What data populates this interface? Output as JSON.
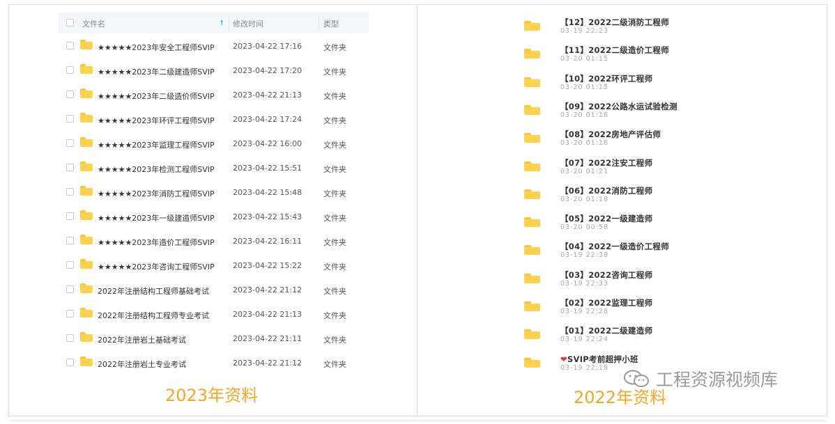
{
  "left_panel": {
    "header": {
      "name": "文件名",
      "time": "修改时间",
      "type": "类型"
    },
    "rows": [
      {
        "name": "★★★★★2023年安全工程师SVIP",
        "time": "2023-04-22 17:16",
        "type": "文件夹"
      },
      {
        "name": "★★★★★2023年二级建造师SVIP",
        "time": "2023-04-22 17:20",
        "type": "文件夹"
      },
      {
        "name": "★★★★★2023年二级造价师SVIP",
        "time": "2023-04-22 21:13",
        "type": "文件夹"
      },
      {
        "name": "★★★★★2023年环评工程师SVIP",
        "time": "2023-04-22 17:24",
        "type": "文件夹"
      },
      {
        "name": "★★★★★2023年监理工程师SVIP",
        "time": "2023-04-22 16:00",
        "type": "文件夹"
      },
      {
        "name": "★★★★★2023年检测工程师SVIP",
        "time": "2023-04-22 15:51",
        "type": "文件夹"
      },
      {
        "name": "★★★★★2023年消防工程师SVIP",
        "time": "2023-04-22 15:48",
        "type": "文件夹"
      },
      {
        "name": "★★★★★2023年一级建造师SVIP",
        "time": "2023-04-22 15:43",
        "type": "文件夹"
      },
      {
        "name": "★★★★★2023年造价工程师SVIP",
        "time": "2023-04-22 16:11",
        "type": "文件夹"
      },
      {
        "name": "★★★★★2023年咨询工程师SVIP",
        "time": "2023-04-22 15:22",
        "type": "文件夹"
      },
      {
        "name": "2022年注册结构工程师基础考试",
        "time": "2023-04-22 21:12",
        "type": "文件夹"
      },
      {
        "name": "2022年注册结构工程师专业考试",
        "time": "2023-04-22 21:13",
        "type": "文件夹"
      },
      {
        "name": "2022年注册岩土基础考试",
        "time": "2023-04-22 21:11",
        "type": "文件夹"
      },
      {
        "name": "2022年注册岩土专业考试",
        "time": "2023-04-22 21:12",
        "type": "文件夹"
      }
    ],
    "caption": "2023年资料"
  },
  "right_panel": {
    "items": [
      {
        "title": "【12】2022二级消防工程师",
        "date": "03-19  22:23"
      },
      {
        "title": "【11】2022二级造价工程师",
        "date": "03-20  01:15"
      },
      {
        "title": "【10】2022环评工程师",
        "date": "03-20  01:15"
      },
      {
        "title": "【09】2022公路水运试验检测",
        "date": "03-20  01:16"
      },
      {
        "title": "【08】2022房地产评估师",
        "date": "03-20  01:16"
      },
      {
        "title": "【07】2022注安工程师",
        "date": "03-20  01:21"
      },
      {
        "title": "【06】2022消防工程师",
        "date": "03-20  01:18"
      },
      {
        "title": "【05】2022一级建造师",
        "date": "03-20  00:58"
      },
      {
        "title": "【04】2022一级造价工程师",
        "date": "03-19  22:38"
      },
      {
        "title": "【03】2022咨询工程师",
        "date": "03-19  22:33"
      },
      {
        "title": "【02】2022监理工程师",
        "date": "03-19  22:28"
      },
      {
        "title": "【01】2022二级建造师",
        "date": "03-19  22:24"
      },
      {
        "title": "SVIP考前超押小班",
        "date": "03-19  22:18",
        "heart": "❤"
      }
    ],
    "caption": "2022年资料"
  },
  "watermark": {
    "text": "工程资源视频库",
    "icon": "wechat-icon"
  },
  "colors": {
    "folder": "#ffd24d",
    "caption": "#f5a623",
    "accent": "#2f8cf0"
  }
}
